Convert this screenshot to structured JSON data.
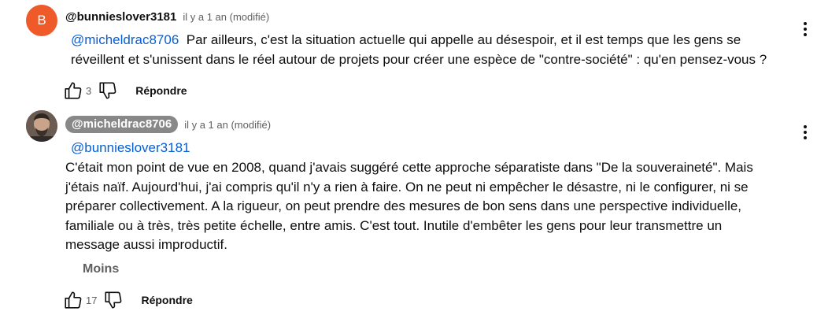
{
  "comments": [
    {
      "avatar_letter": "B",
      "author": "@bunnieslover3181",
      "time": "il y a 1 an (modifié)",
      "mention": "@micheldrac8706",
      "body": "Par ailleurs, c'est la situation actuelle qui appelle au désespoir, et il est temps que les gens se réveillent et s'unissent dans le réel autour de projets pour créer une espèce de \"contre-société\" : qu'en pensez-vous ?",
      "likes": "3",
      "reply_label": "Répondre",
      "menu_icon": "more-vertical-icon",
      "avatar_color": "#ef5a2b"
    },
    {
      "author": "@micheldrac8706",
      "time": "il y a 1 an (modifié)",
      "mention": "@bunnieslover3181",
      "body": "C'était mon point de vue en 2008, quand j'avais suggéré cette approche séparatiste dans \"De la souveraineté\". Mais j'étais naïf. Aujourd'hui, j'ai compris qu'il n'y a rien à faire. On ne peut ni empêcher le désastre, ni le configurer, ni se préparer collectivement. A la rigueur, on peut prendre des mesures de bon sens dans une perspective individuelle, familiale ou à très, très petite échelle, entre amis. C'est tout. Inutile d'embêter les gens pour leur transmettre un message aussi improductif.",
      "show_less_label": "Moins",
      "likes": "17",
      "reply_label": "Répondre",
      "menu_icon": "more-vertical-icon",
      "author_pill_color": "#888888"
    }
  ],
  "colors": {
    "mention": "#065fd4",
    "secondary_text": "#606060"
  }
}
